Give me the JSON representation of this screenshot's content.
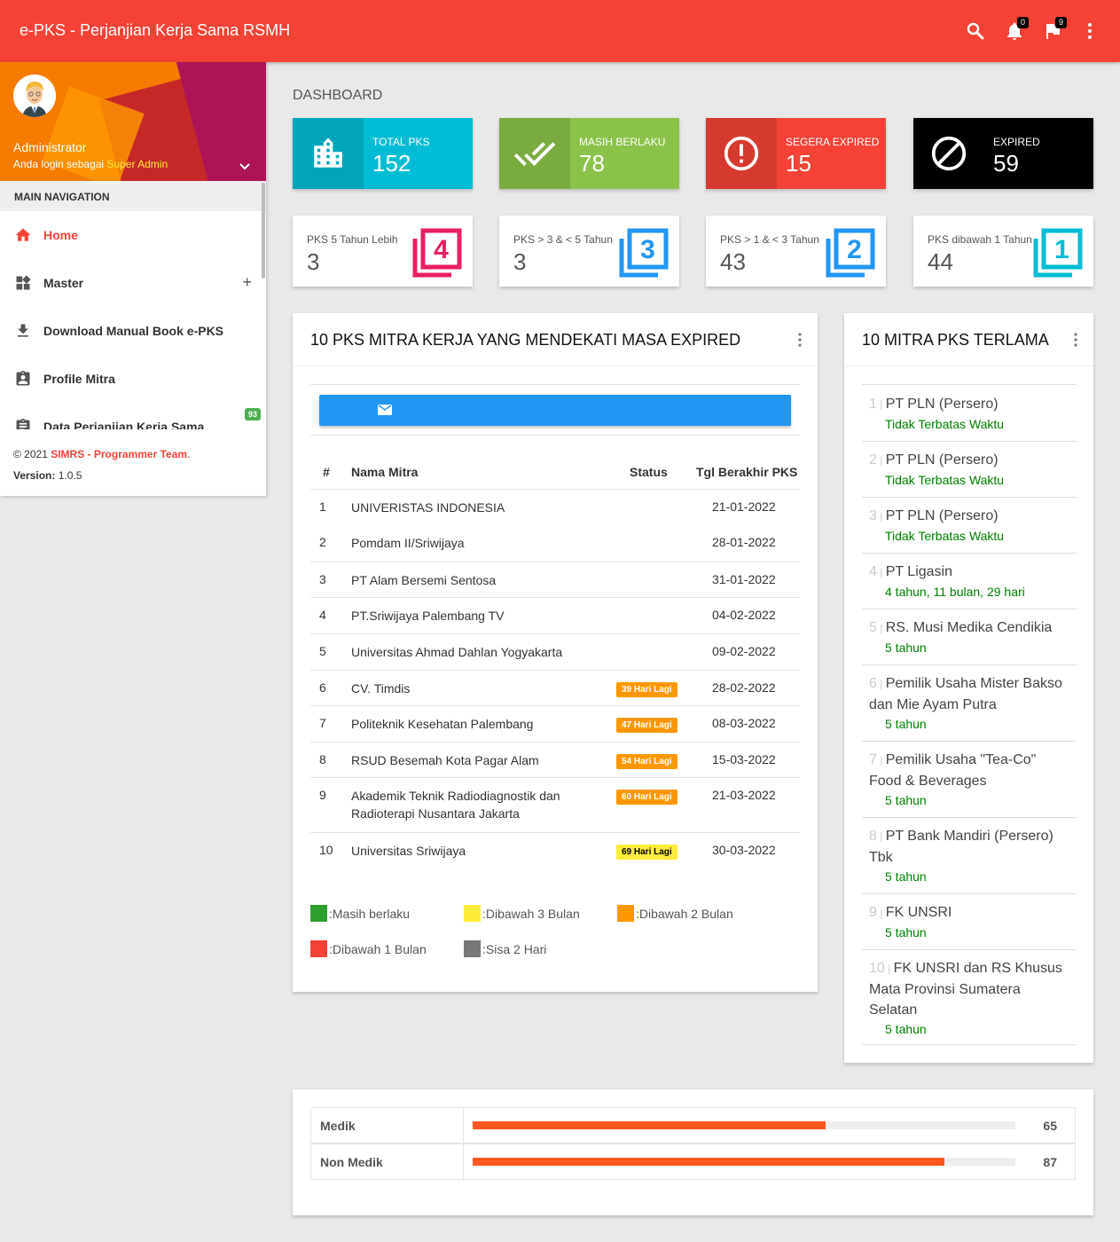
{
  "topbar": {
    "title": "e-PKS - Perjanjian Kerja Sama RSMH",
    "notif_count": "0",
    "flag_count": "9",
    "color": "#f44336"
  },
  "user": {
    "name": "Administrator",
    "login_text": "Anda login sebagai",
    "role": "Super Admin"
  },
  "nav": {
    "header": "MAIN NAVIGATION",
    "items": [
      {
        "label": "Home",
        "icon": "home-icon"
      },
      {
        "label": "Master",
        "icon": "widgets-icon",
        "expand": "+"
      },
      {
        "label": "Download Manual Book e-PKS",
        "icon": "download-icon"
      },
      {
        "label": "Profile Mitra",
        "icon": "contact-icon"
      },
      {
        "label": "Data Perjanjian Kerja Sama",
        "icon": "assignment-icon",
        "badge": "93"
      }
    ]
  },
  "footer": {
    "copyright": "© 2021",
    "team": "SIMRS - Programmer Team",
    "dot": ".",
    "version_label": "Version:",
    "version": "1.0.5"
  },
  "dashboard_title": "DASHBOARD",
  "info_boxes": [
    {
      "label": "TOTAL PKS",
      "value": "152",
      "color": "#00bcd4",
      "icon": "building-icon"
    },
    {
      "label": "MASIH BERLAKU",
      "value": "78",
      "color": "#8bc34a",
      "icon": "double-check-icon"
    },
    {
      "label": "SEGERA EXPIRED",
      "value": "15",
      "color": "#f44336",
      "icon": "alert-circle-icon"
    },
    {
      "label": "EXPIRED",
      "value": "59",
      "color": "#000000",
      "icon": "block-icon"
    }
  ],
  "duration_boxes": [
    {
      "label": "PKS 5 Tahun Lebih",
      "value": "3",
      "color": "#e91e63",
      "icon": "filter-4-icon",
      "digit": "4"
    },
    {
      "label": "PKS > 3 & < 5 Tahun",
      "value": "3",
      "color": "#2196f3",
      "icon": "filter-3-icon",
      "digit": "3"
    },
    {
      "label": "PKS > 1 & < 3 Tahun",
      "value": "43",
      "color": "#2196f3",
      "icon": "filter-2-icon",
      "digit": "2"
    },
    {
      "label": "PKS dibawah 1 Tahun",
      "value": "44",
      "color": "#00bcd4",
      "icon": "filter-1-icon",
      "digit": "1"
    }
  ],
  "expiring": {
    "title": "10 PKS MITRA KERJA YANG MENDEKATI MASA EXPIRED",
    "columns": [
      "#",
      "Nama Mitra",
      "Status",
      "Tgl Berakhir PKS"
    ],
    "rows": [
      {
        "no": "1",
        "name": "UNIVERISTAS INDONESIA",
        "status": "",
        "date": "21-01-2022"
      },
      {
        "no": "2",
        "name": "Pomdam II/Sriwijaya",
        "status": "",
        "date": "28-01-2022"
      },
      {
        "no": "3",
        "name": "PT Alam Bersemi Sentosa",
        "status": "",
        "date": "31-01-2022"
      },
      {
        "no": "4",
        "name": "PT.Sriwijaya Palembang TV",
        "status": "",
        "date": "04-02-2022"
      },
      {
        "no": "5",
        "name": "Universitas Ahmad Dahlan Yogyakarta",
        "status": "",
        "date": "09-02-2022"
      },
      {
        "no": "6",
        "name": "CV. Timdis",
        "status": "39 Hari Lagi",
        "status_color": "#ff9800",
        "date": "28-02-2022"
      },
      {
        "no": "7",
        "name": "Politeknik Kesehatan Palembang",
        "status": "47 Hari Lagi",
        "status_color": "#ff9800",
        "date": "08-03-2022"
      },
      {
        "no": "8",
        "name": "RSUD Besemah Kota Pagar Alam",
        "status": "54 Hari Lagi",
        "status_color": "#ff9800",
        "date": "15-03-2022"
      },
      {
        "no": "9",
        "name": "Akademik Teknik Radiodiagnostik dan Radioterapi Nusantara Jakarta",
        "status": "60 Hari Lagi",
        "status_color": "#ff9800",
        "date": "21-03-2022"
      },
      {
        "no": "10",
        "name": "Universitas Sriwijaya",
        "status": "69 Hari Lagi",
        "status_color": "#ffeb3b",
        "date": "30-03-2022"
      }
    ],
    "legend": [
      {
        "label": ":Masih berlaku",
        "color": "#2e9e2e"
      },
      {
        "label": ":Dibawah 3 Bulan",
        "color": "#ffeb3b"
      },
      {
        "label": ":Dibawah 2 Bulan",
        "color": "#ff9800"
      },
      {
        "label": ":Dibawah 1 Bulan",
        "color": "#f44336"
      },
      {
        "label": ":Sisa 2 Hari",
        "color": "#777777"
      }
    ]
  },
  "oldest": {
    "title": "10 MITRA PKS TERLAMA",
    "items": [
      {
        "no": "1",
        "name": "PT PLN (Persero)",
        "duration": "Tidak Terbatas Waktu"
      },
      {
        "no": "2",
        "name": "PT PLN (Persero)",
        "duration": "Tidak Terbatas Waktu"
      },
      {
        "no": "3",
        "name": "PT PLN (Persero)",
        "duration": "Tidak Terbatas Waktu"
      },
      {
        "no": "4",
        "name": "PT Ligasin",
        "duration": "4 tahun, 11 bulan, 29 hari"
      },
      {
        "no": "5",
        "name": "RS. Musi Medika Cendikia",
        "duration": "5 tahun"
      },
      {
        "no": "6",
        "name": "Pemilik Usaha Mister Bakso dan Mie Ayam Putra",
        "duration": "5 tahun"
      },
      {
        "no": "7",
        "name": "Pemilik Usaha \"Tea-Co\" Food & Beverages",
        "duration": "5 tahun"
      },
      {
        "no": "8",
        "name": "PT Bank Mandiri (Persero) Tbk",
        "duration": "5 tahun"
      },
      {
        "no": "9",
        "name": "FK UNSRI",
        "duration": "5 tahun"
      },
      {
        "no": "10",
        "name": "FK UNSRI dan RS Khusus Mata Provinsi Sumatera Selatan",
        "duration": "5 tahun"
      }
    ]
  },
  "progress": {
    "color": "#ff5722",
    "rows": [
      {
        "label": "Medik",
        "value": "65",
        "fraction": 0.65
      },
      {
        "label": "Non Medik",
        "value": "87",
        "fraction": 0.87
      }
    ]
  }
}
